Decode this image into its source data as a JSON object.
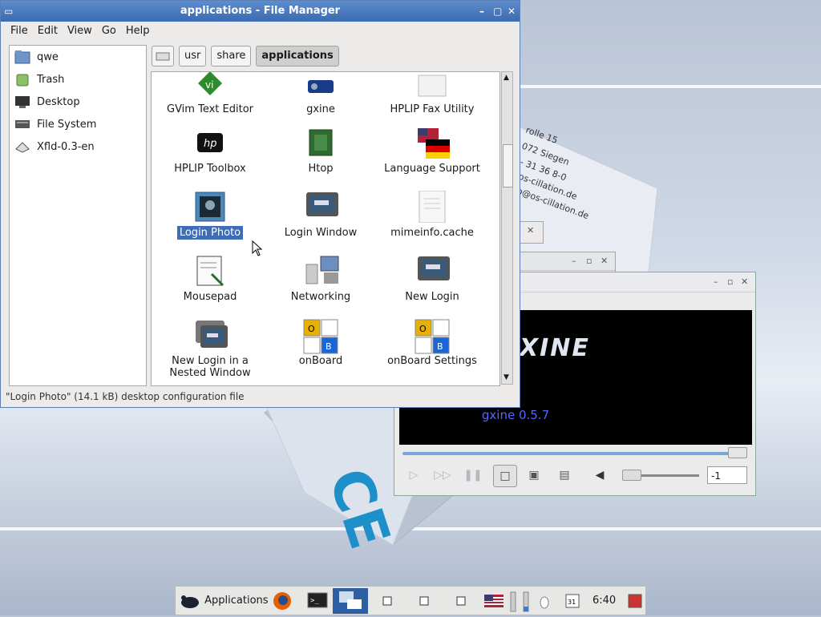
{
  "file_manager": {
    "title": "applications - File Manager",
    "menu": [
      "File",
      "Edit",
      "View",
      "Go",
      "Help"
    ],
    "sidebar": [
      "qwe",
      "Trash",
      "Desktop",
      "File System",
      "Xfld-0.3-en"
    ],
    "path": [
      "usr",
      "share",
      "applications"
    ],
    "items": [
      {
        "label": "GVim Text Editor",
        "icon": "gvim-icon"
      },
      {
        "label": "gxine",
        "icon": "gxine-icon"
      },
      {
        "label": "HPLIP Fax Utility",
        "icon": "fax-icon"
      },
      {
        "label": "HPLIP Toolbox",
        "icon": "hp-logo-icon"
      },
      {
        "label": "Htop",
        "icon": "chip-icon"
      },
      {
        "label": "Language Support",
        "icon": "flags-icon"
      },
      {
        "label": "Login Photo",
        "icon": "photo-icon",
        "selected": true
      },
      {
        "label": "Login Window",
        "icon": "monitor-icon"
      },
      {
        "label": "mimeinfo.cache",
        "icon": "document-icon"
      },
      {
        "label": "Mousepad",
        "icon": "notepad-icon"
      },
      {
        "label": "Networking",
        "icon": "network-icon"
      },
      {
        "label": "New Login",
        "icon": "monitor-icon"
      },
      {
        "label": "New Login in a Nested Window",
        "icon": "nested-monitor-icon"
      },
      {
        "label": "onBoard",
        "icon": "keyboard-icon"
      },
      {
        "label": "onBoard Settings",
        "icon": "keyboard-icon"
      }
    ],
    "status": "\"Login Photo\" (14.1 kB) desktop configuration file",
    "kbd_keys": [
      "O",
      "B"
    ]
  },
  "gxine": {
    "version": "gxine 0.5.7",
    "logo": "XINE",
    "spin_value": "-1"
  },
  "taskbar": {
    "applications_label": "Applications",
    "clock": "6:40",
    "calendar_day": "31"
  }
}
